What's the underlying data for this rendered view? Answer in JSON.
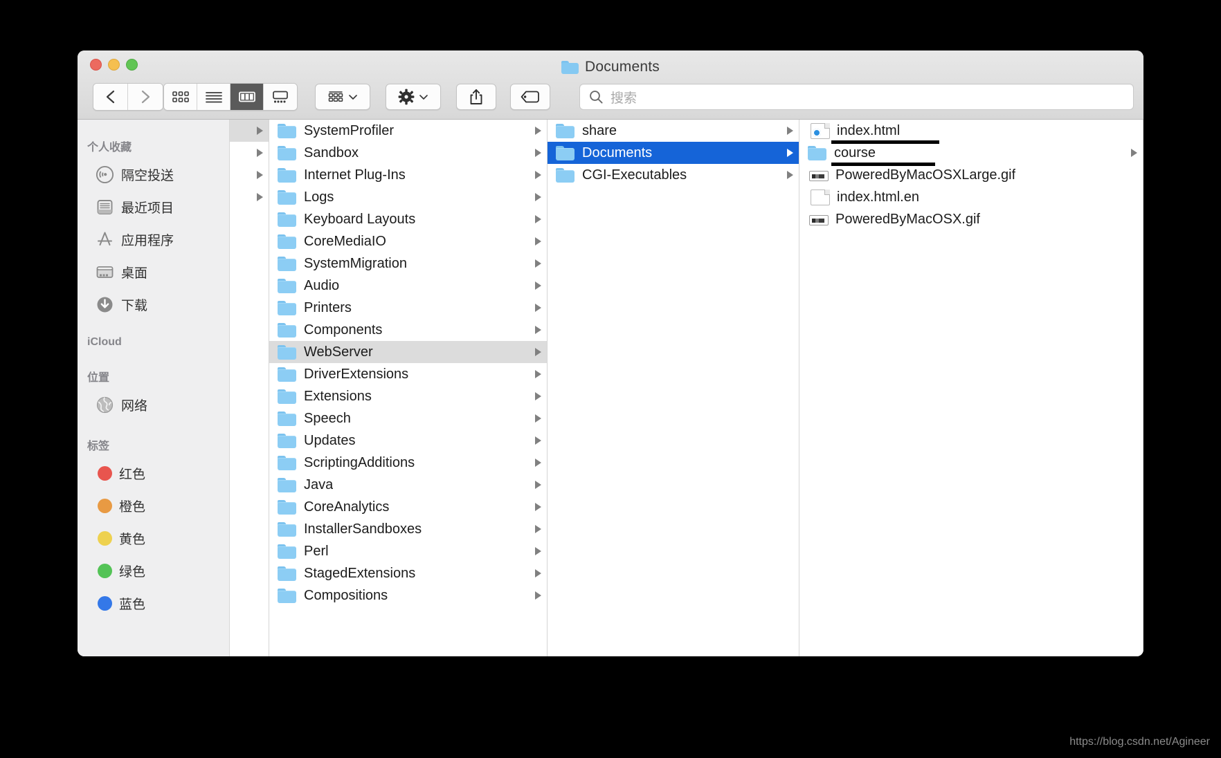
{
  "window": {
    "title": "Documents",
    "title_icon": "folder-icon",
    "traffic_lights": [
      {
        "name": "close",
        "color": "#ec6a5f"
      },
      {
        "name": "minimize",
        "color": "#f5bf4f"
      },
      {
        "name": "maximize",
        "color": "#61c554"
      }
    ]
  },
  "toolbar": {
    "back_label": "back-icon",
    "forward_label": "forward-icon",
    "view_modes": [
      {
        "name": "icon-view",
        "icon": "grid-icon",
        "active": false
      },
      {
        "name": "list-view",
        "icon": "list-icon",
        "active": false
      },
      {
        "name": "column-view",
        "icon": "columns-icon",
        "active": true
      },
      {
        "name": "gallery-view",
        "icon": "gallery-icon",
        "active": false
      }
    ],
    "arrange_icon": "arrange-icon",
    "action_icon": "gear-icon",
    "share_icon": "share-icon",
    "tags_icon": "tag-icon",
    "search": {
      "icon": "search-icon",
      "placeholder": "搜索",
      "value": ""
    }
  },
  "sidebar": {
    "sections": [
      {
        "header": "个人收藏",
        "items": [
          {
            "label": "隔空投送",
            "icon": "airdrop-icon"
          },
          {
            "label": "最近项目",
            "icon": "recents-icon"
          },
          {
            "label": "应用程序",
            "icon": "applications-icon"
          },
          {
            "label": "桌面",
            "icon": "desktop-icon"
          },
          {
            "label": "下载",
            "icon": "downloads-icon"
          }
        ]
      },
      {
        "header": "iCloud",
        "items": []
      },
      {
        "header": "位置",
        "items": [
          {
            "label": "网络",
            "icon": "network-icon"
          }
        ]
      },
      {
        "header": "标签",
        "items": [
          {
            "label": "红色",
            "icon": "tag-dot-icon",
            "color": "#e8554e"
          },
          {
            "label": "橙色",
            "icon": "tag-dot-icon",
            "color": "#e89a43"
          },
          {
            "label": "黄色",
            "icon": "tag-dot-icon",
            "color": "#eed14f"
          },
          {
            "label": "绿色",
            "icon": "tag-dot-icon",
            "color": "#53c356"
          },
          {
            "label": "蓝色",
            "icon": "tag-dot-icon",
            "color": "#3478e8"
          }
        ]
      }
    ]
  },
  "columns": {
    "stub": {
      "rows": [
        {
          "chevron": true,
          "selected": true
        },
        {
          "chevron": true,
          "selected": false
        },
        {
          "chevron": true,
          "selected": false
        },
        {
          "chevron": true,
          "selected": false
        },
        {
          "chevron": false,
          "selected": false
        },
        {
          "chevron": false,
          "selected": false
        },
        {
          "chevron": false,
          "selected": false
        },
        {
          "chevron": false,
          "selected": false
        },
        {
          "chevron": false,
          "selected": false
        }
      ]
    },
    "column1": {
      "items": [
        {
          "name": "SystemProfiler",
          "icon": "folder-icon",
          "chevron": true,
          "selected": false
        },
        {
          "name": "Sandbox",
          "icon": "folder-icon",
          "chevron": true,
          "selected": false
        },
        {
          "name": "Internet Plug-Ins",
          "icon": "folder-icon",
          "chevron": true,
          "selected": false
        },
        {
          "name": "Logs",
          "icon": "folder-icon",
          "chevron": true,
          "selected": false
        },
        {
          "name": "Keyboard Layouts",
          "icon": "folder-icon",
          "chevron": true,
          "selected": false
        },
        {
          "name": "CoreMediaIO",
          "icon": "folder-icon",
          "chevron": true,
          "selected": false
        },
        {
          "name": "SystemMigration",
          "icon": "folder-icon",
          "chevron": true,
          "selected": false
        },
        {
          "name": "Audio",
          "icon": "folder-icon",
          "chevron": true,
          "selected": false
        },
        {
          "name": "Printers",
          "icon": "folder-icon",
          "chevron": true,
          "selected": false
        },
        {
          "name": "Components",
          "icon": "folder-icon",
          "chevron": true,
          "selected": false
        },
        {
          "name": "WebServer",
          "icon": "folder-icon",
          "chevron": true,
          "selected": true
        },
        {
          "name": "DriverExtensions",
          "icon": "folder-icon",
          "chevron": true,
          "selected": false
        },
        {
          "name": "Extensions",
          "icon": "folder-icon",
          "chevron": true,
          "selected": false
        },
        {
          "name": "Speech",
          "icon": "folder-icon",
          "chevron": true,
          "selected": false
        },
        {
          "name": "Updates",
          "icon": "folder-icon",
          "chevron": true,
          "selected": false
        },
        {
          "name": "ScriptingAdditions",
          "icon": "folder-icon",
          "chevron": true,
          "selected": false
        },
        {
          "name": "Java",
          "icon": "folder-icon",
          "chevron": true,
          "selected": false
        },
        {
          "name": "CoreAnalytics",
          "icon": "folder-icon",
          "chevron": true,
          "selected": false
        },
        {
          "name": "InstallerSandboxes",
          "icon": "folder-icon",
          "chevron": true,
          "selected": false
        },
        {
          "name": "Perl",
          "icon": "folder-icon",
          "chevron": true,
          "selected": false
        },
        {
          "name": "StagedExtensions",
          "icon": "folder-icon",
          "chevron": true,
          "selected": false
        },
        {
          "name": "Compositions",
          "icon": "folder-icon",
          "chevron": true,
          "selected": false
        }
      ]
    },
    "column2": {
      "items": [
        {
          "name": "share",
          "icon": "folder-icon",
          "chevron": true,
          "selected": false
        },
        {
          "name": "Documents",
          "icon": "folder-icon",
          "chevron": true,
          "selected": true
        },
        {
          "name": "CGI-Executables",
          "icon": "folder-icon",
          "chevron": true,
          "selected": false
        }
      ]
    },
    "column3": {
      "items": [
        {
          "name": "index.html",
          "icon": "html-file-icon",
          "chevron": false,
          "selected": false,
          "underlined": true
        },
        {
          "name": "course",
          "icon": "folder-icon",
          "chevron": true,
          "selected": false,
          "underlined": true
        },
        {
          "name": "PoweredByMacOSXLarge.gif",
          "icon": "gif-file-icon",
          "chevron": false,
          "selected": false,
          "underlined": false
        },
        {
          "name": "index.html.en",
          "icon": "doc-file-icon",
          "chevron": false,
          "selected": false,
          "underlined": false
        },
        {
          "name": "PoweredByMacOSX.gif",
          "icon": "gif-file-icon",
          "chevron": false,
          "selected": false,
          "underlined": false
        }
      ]
    }
  },
  "watermark": "https://blog.csdn.net/Agineer"
}
